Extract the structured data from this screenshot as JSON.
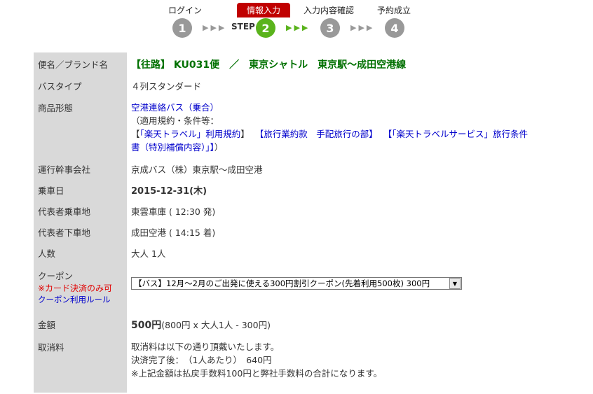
{
  "steps": {
    "labels": [
      "ログイン",
      "情報入力",
      "入力内容確認",
      "予約成立"
    ],
    "numbers": [
      "1",
      "2",
      "3",
      "4"
    ],
    "step_word": "STEP",
    "arrow": "▶▶▶"
  },
  "table": {
    "flight": {
      "label": "便名／ブランド名",
      "value": "【往路】 KU031便　／　東京シャトル　東京駅～成田空港線"
    },
    "bus_type": {
      "label": "バスタイプ",
      "value": "４列スタンダード"
    },
    "product": {
      "label": "商品形態",
      "link": "空港連絡バス（乗合）",
      "terms_intro": "（適用規約・条件等：",
      "bracket_open": "【",
      "link_rakuten_travel": "「楽天トラベル」利用規約",
      "bracket_close": "】",
      "link_travel_terms": "【旅行業約款　手配旅行の部】",
      "link_service_a": "【「楽天トラベルサービス」旅行条件",
      "link_service_b": "書（特別補償内容）」】",
      "terms_close": "）"
    },
    "operator": {
      "label": "運行幹事会社",
      "value": "京成バス（株）東京駅～成田空港"
    },
    "date": {
      "label": "乗車日",
      "value": "2015-12-31(木)"
    },
    "boarding": {
      "label": "代表者乗車地",
      "value": "東雲車庫 ( 12:30 発)"
    },
    "alighting": {
      "label": "代表者下車地",
      "value": "成田空港 ( 14:15 着)"
    },
    "people": {
      "label": "人数",
      "value": "大人 1人"
    },
    "coupon": {
      "label": "クーポン",
      "note": "※カード決済のみ可",
      "rule_link": "クーポン利用ルール",
      "selected": "【バス】12月～2月のご出発に使える300円割引クーポン(先着利用500枚)  300円"
    },
    "price": {
      "label": "金額",
      "amount": "500円",
      "detail": "(800円 x 大人1人 - 300円)"
    },
    "cancel": {
      "label": "取消料",
      "line1": "取消料は以下の通り頂戴いたします。",
      "line2": "決済完了後：　（1人あたり）　640円",
      "line3": "※上記金額は払戻手数料100円と弊社手数料の合計になります。"
    }
  }
}
